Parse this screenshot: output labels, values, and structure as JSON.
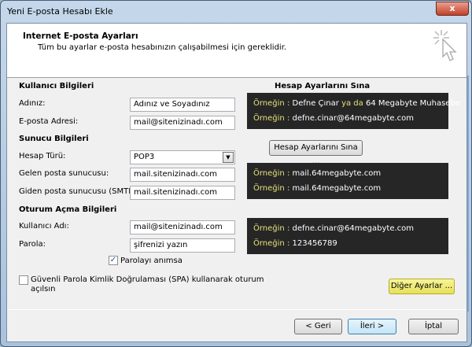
{
  "window": {
    "title": "Yeni E-posta Hesabı Ekle",
    "close": "x"
  },
  "header": {
    "title": "Internet E-posta Ayarları",
    "subtitle": "Tüm bu ayarlar e-posta hesabınızın çalışabilmesi için gereklidir.",
    "icon": "cursor-sparkle-icon"
  },
  "user": {
    "section": "Kullanıcı Bilgileri",
    "name_label": "Adınız:",
    "name_value": "Adınız ve Soyadınız",
    "email_label": "E-posta Adresi:",
    "email_value": "mail@sitenizinadı.com"
  },
  "server": {
    "section": "Sunucu Bilgileri",
    "type_label": "Hesap Türü:",
    "type_value": "POP3",
    "in_label": "Gelen posta sunucusu:",
    "in_value": "mail.sitenizinadı.com",
    "out_label": "Giden posta sunucusu (SMTP):",
    "out_value": "mail.sitenizinadı.com"
  },
  "logon": {
    "section": "Oturum Açma Bilgileri",
    "user_label": "Kullanıcı Adı:",
    "user_value": "mail@sitenizinadı.com",
    "pass_label": "Parola:",
    "pass_value": "şifrenizi yazın",
    "remember_label": "Parolayı anımsa",
    "remember_checked": true,
    "spa_label1": "Güvenli Parola Kimlik Doğrulaması (SPA) kullanarak oturum",
    "spa_label2": "açılsın",
    "spa_checked": false
  },
  "test": {
    "section": "Hesap Ayarlarını Sına",
    "button": "Hesap Ayarlarını Sına ..."
  },
  "hints": {
    "prefix": "Örneğin :",
    "h1a": "Defne Çınar",
    "h1or": "ya da",
    "h1b": "64 Megabyte Muhasebe",
    "h2": "defne.cinar@64megabyte.com",
    "h3": "mail.64megabyte.com",
    "h4": "mail.64megabyte.com",
    "h5": "defne.cinar@64megabyte.com",
    "h6": "123456789"
  },
  "buttons": {
    "more": "Diğer Ayarlar ...",
    "back": "< Geri",
    "next": "İleri >",
    "cancel": "İptal"
  }
}
